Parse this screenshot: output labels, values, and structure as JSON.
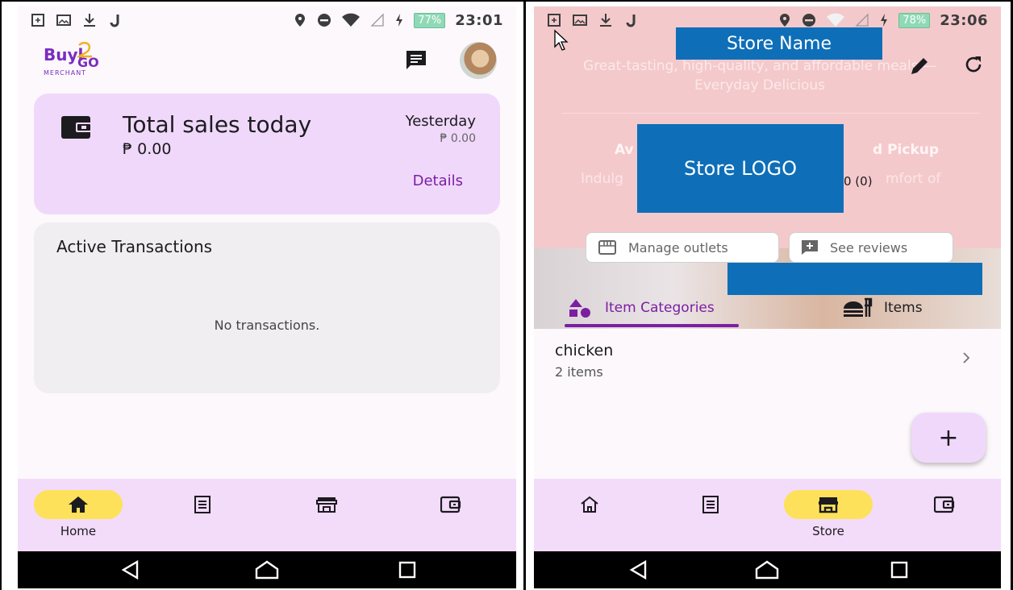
{
  "phone_home": {
    "status": {
      "time": "23:01",
      "battery": "77%"
    },
    "logo_text": {
      "line1": "Buyl",
      "line2": "GO",
      "line3": "MERCHANT"
    },
    "sales": {
      "title": "Total sales today",
      "amount": "₱ 0.00",
      "yesterday_label": "Yesterday",
      "yesterday_amount": "₱ 0.00",
      "details_label": "Details"
    },
    "transactions": {
      "title": "Active Transactions",
      "empty_text": "No transactions."
    },
    "bottom_nav": {
      "items": [
        {
          "icon": "home-icon",
          "label": "Home",
          "active": true
        },
        {
          "icon": "orders-icon",
          "label": "",
          "active": false
        },
        {
          "icon": "store-icon",
          "label": "",
          "active": false
        },
        {
          "icon": "wallet-icon",
          "label": "",
          "active": false
        }
      ]
    }
  },
  "phone_store": {
    "status": {
      "time": "23:06",
      "battery": "78%"
    },
    "store_name_redacted": "Store Name",
    "store_logo_redacted": "Store LOGO",
    "description": "Great-tasting, high-quality, and affordable meals — Everyday Delicious",
    "ghost_labels": {
      "left_heading": "Av",
      "right_heading": "d Pickup",
      "left_text": "Indulg",
      "right_text": "mfort of"
    },
    "rating": "0 (0)",
    "buttons": {
      "manage_outlets": "Manage outlets",
      "see_reviews": "See reviews"
    },
    "tabs": [
      {
        "label": "Item Categories",
        "active": true
      },
      {
        "label": "Items",
        "active": false
      }
    ],
    "categories": [
      {
        "name": "chicken",
        "count": "2 items"
      }
    ],
    "fab_label": "+",
    "bottom_nav": {
      "items": [
        {
          "icon": "home-outline-icon",
          "label": "",
          "active": false
        },
        {
          "icon": "orders-icon",
          "label": "",
          "active": false
        },
        {
          "icon": "store-icon",
          "label": "Store",
          "active": true
        },
        {
          "icon": "wallet-icon",
          "label": "",
          "active": false
        }
      ]
    }
  },
  "colors": {
    "accent_purple": "#7b1fa2",
    "card_lavender": "#f0d8fb",
    "nav_active_yellow": "#fde15a",
    "redaction_blue": "#0e6fb8",
    "hero_pink": "#f4c9cc"
  }
}
